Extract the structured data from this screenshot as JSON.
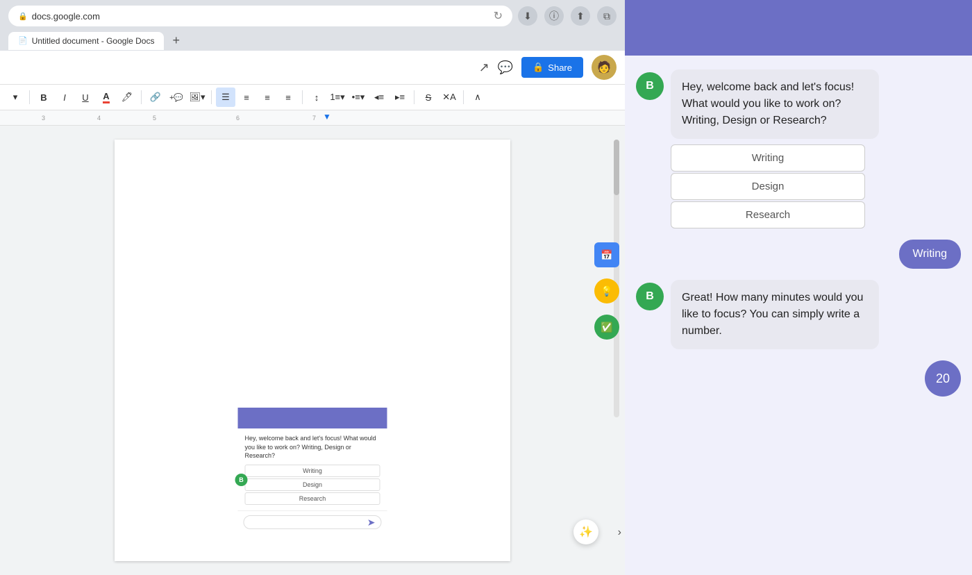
{
  "browser": {
    "url": "docs.google.com",
    "tab_title": "Untitled document - Google Docs",
    "refresh_icon": "↻",
    "lock_icon": "🔒",
    "action_icons": [
      "⬇",
      "ⓘ",
      "⬆",
      "⧉"
    ],
    "new_tab_label": "+"
  },
  "toolbar": {
    "font_size_dropdown": "▾",
    "bold": "B",
    "italic": "I",
    "underline": "U",
    "text_color": "A",
    "highlight": "🖊",
    "link": "🔗",
    "add_comment": "💬+",
    "image": "🖼",
    "align_left": "≡",
    "align_center": "≡",
    "align_right": "≡",
    "align_justify": "≡",
    "line_spacing": "↕≡",
    "numbered_list": "1≡",
    "bullet_list": "•≡",
    "decrease_indent": "◂≡",
    "increase_indent": "▸≡",
    "strikethrough": "S̶",
    "format_clear": "✕A",
    "expand": "∧",
    "share_label": "Share",
    "lock_share": "🔒"
  },
  "ruler": {
    "ticks": [
      "3",
      "4",
      "5",
      "6",
      "7"
    ]
  },
  "chat": {
    "header_color": "#6c6fc5",
    "bot_avatar_label": "B",
    "bot_avatar_color": "#34a853",
    "welcome_message": "Hey, welcome back and let's focus! What would you like to work on? Writing, Design or Research?",
    "options": [
      {
        "label": "Writing"
      },
      {
        "label": "Design"
      },
      {
        "label": "Research"
      }
    ],
    "user_reply": "Writing",
    "second_bot_message": "Great! How many minutes would you like to focus? You can simply write a number.",
    "user_number": "20"
  },
  "embedded_chat": {
    "message": "Hey, welcome back and let's focus! What would you like to work on? Writing, Design or Research?",
    "options": [
      "Writing",
      "Design",
      "Research"
    ],
    "bot_avatar": "B"
  },
  "icons": {
    "calendar": "📅",
    "bulb": "💡",
    "checkmark": "✅",
    "magic": "✨",
    "trend": "↗",
    "comment": "💬"
  }
}
